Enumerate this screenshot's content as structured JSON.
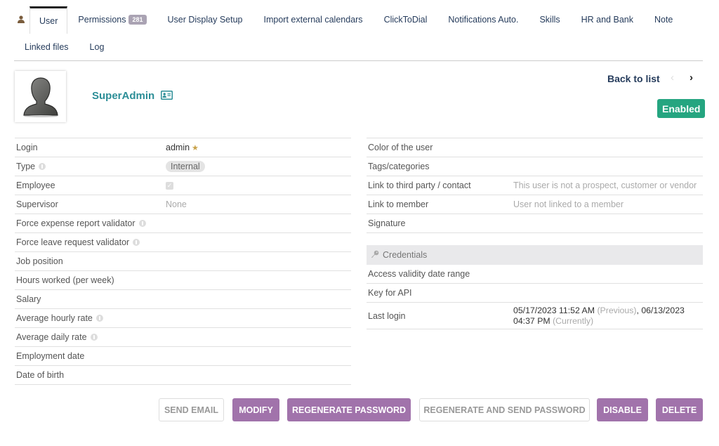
{
  "tabs": {
    "row1": [
      {
        "id": "user",
        "label": "User",
        "active": true
      },
      {
        "id": "permissions",
        "label": "Permissions",
        "badge": "281"
      },
      {
        "id": "user-display-setup",
        "label": "User Display Setup"
      },
      {
        "id": "import-external-calendars",
        "label": "Import external calendars"
      },
      {
        "id": "clicktodial",
        "label": "ClickToDial"
      },
      {
        "id": "notifications-auto",
        "label": "Notifications Auto."
      },
      {
        "id": "skills",
        "label": "Skills"
      },
      {
        "id": "hr-and-bank",
        "label": "HR and Bank"
      },
      {
        "id": "note",
        "label": "Note"
      }
    ],
    "row2": [
      {
        "id": "linked-files",
        "label": "Linked files"
      },
      {
        "id": "log",
        "label": "Log"
      }
    ]
  },
  "header": {
    "user_name": "SuperAdmin",
    "back_to_list": "Back to list",
    "prev": "‹",
    "next": "›",
    "status": "Enabled",
    "status_color": "#25a580"
  },
  "left_fields": [
    {
      "label": "Login",
      "value": "admin",
      "star": true
    },
    {
      "label": "Type",
      "value": "Internal",
      "info": true,
      "pill": true
    },
    {
      "label": "Employee",
      "value": "✓",
      "checkbox": true,
      "checked": true
    },
    {
      "label": "Supervisor",
      "value": "None",
      "muted": true
    },
    {
      "label": "Force expense report validator",
      "value": "",
      "info": true
    },
    {
      "label": "Force leave request validator",
      "value": "",
      "info": true
    },
    {
      "label": "Job position",
      "value": ""
    },
    {
      "label": "Hours worked (per week)",
      "value": ""
    },
    {
      "label": "Salary",
      "value": ""
    },
    {
      "label": "Average hourly rate",
      "value": "",
      "info": true
    },
    {
      "label": "Average daily rate",
      "value": "",
      "info": true
    },
    {
      "label": "Employment date",
      "value": ""
    },
    {
      "label": "Date of birth",
      "value": ""
    }
  ],
  "right_fields": [
    {
      "label": "Color of the user",
      "value": ""
    },
    {
      "label": "Tags/categories",
      "value": ""
    },
    {
      "label": "Link to third party / contact",
      "value": "This user is not a prospect, customer or vendor",
      "muted": true
    },
    {
      "label": "Link to member",
      "value": "User not linked to a member",
      "muted": true
    },
    {
      "label": "Signature",
      "value": ""
    }
  ],
  "credentials": {
    "title": "Credentials",
    "fields": [
      {
        "label": "Access validity date range",
        "value": ""
      },
      {
        "label": "Key for API",
        "value": ""
      }
    ],
    "last_login": {
      "label": "Last login",
      "previous_date": "05/17/2023 11:52 AM",
      "previous_tag": "(Previous)",
      "separator": ",",
      "current_date_line1": "06/13/2023",
      "current_date_line2": "04:37 PM",
      "current_tag": "(Currently)"
    }
  },
  "actions": {
    "send_email": "Send email",
    "modify": "Modify",
    "regenerate_password": "Regenerate password",
    "regenerate_and_send_password": "Regenerate and send password",
    "disable": "Disable",
    "delete": "Delete"
  },
  "colors": {
    "accent_purple": "#a173ab",
    "user_name_teal": "#2c8e97",
    "link_navy": "#263c5c"
  }
}
